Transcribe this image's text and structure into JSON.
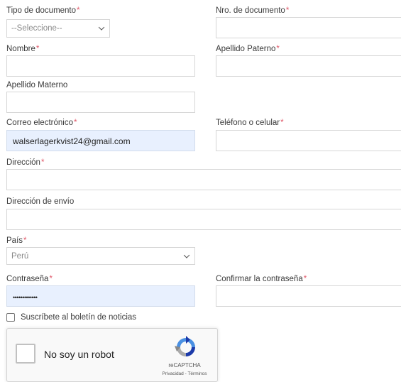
{
  "form": {
    "tipo_documento": {
      "label": "Tipo de documento",
      "required_mark": "*",
      "selected": "--Seleccione--"
    },
    "nro_documento": {
      "label": "Nro. de documento",
      "required_mark": "*",
      "value": ""
    },
    "nombre": {
      "label": "Nombre",
      "required_mark": "*",
      "value": ""
    },
    "apellido_paterno": {
      "label": "Apellido Paterno",
      "required_mark": "*",
      "value": ""
    },
    "apellido_materno": {
      "label": "Apellido Materno",
      "value": ""
    },
    "correo": {
      "label": "Correo electrónico",
      "required_mark": "*",
      "value": "walserlagerkvist24@gmail.com"
    },
    "telefono": {
      "label": "Teléfono o celular",
      "required_mark": "*",
      "value": ""
    },
    "direccion": {
      "label": "Dirección",
      "required_mark": "*",
      "value": ""
    },
    "direccion_envio": {
      "label": "Dirección de envío",
      "value": ""
    },
    "pais": {
      "label": "País",
      "required_mark": "*",
      "selected": "Perú"
    },
    "contrasena": {
      "label": "Contraseña",
      "required_mark": "*",
      "value": "•••••••••••••"
    },
    "confirmar_contrasena": {
      "label": "Confirmar la contraseña",
      "required_mark": "*",
      "value": ""
    },
    "newsletter": {
      "label": "Suscríbete al boletín de noticias",
      "checked": false
    }
  },
  "recaptcha": {
    "label": "No soy un robot",
    "brand": "reCAPTCHA",
    "links": "Privacidad - Términos"
  },
  "colors": {
    "required": "#e05a6b",
    "autofill_bg": "#e8f0fe",
    "border": "#d6d6d6"
  }
}
